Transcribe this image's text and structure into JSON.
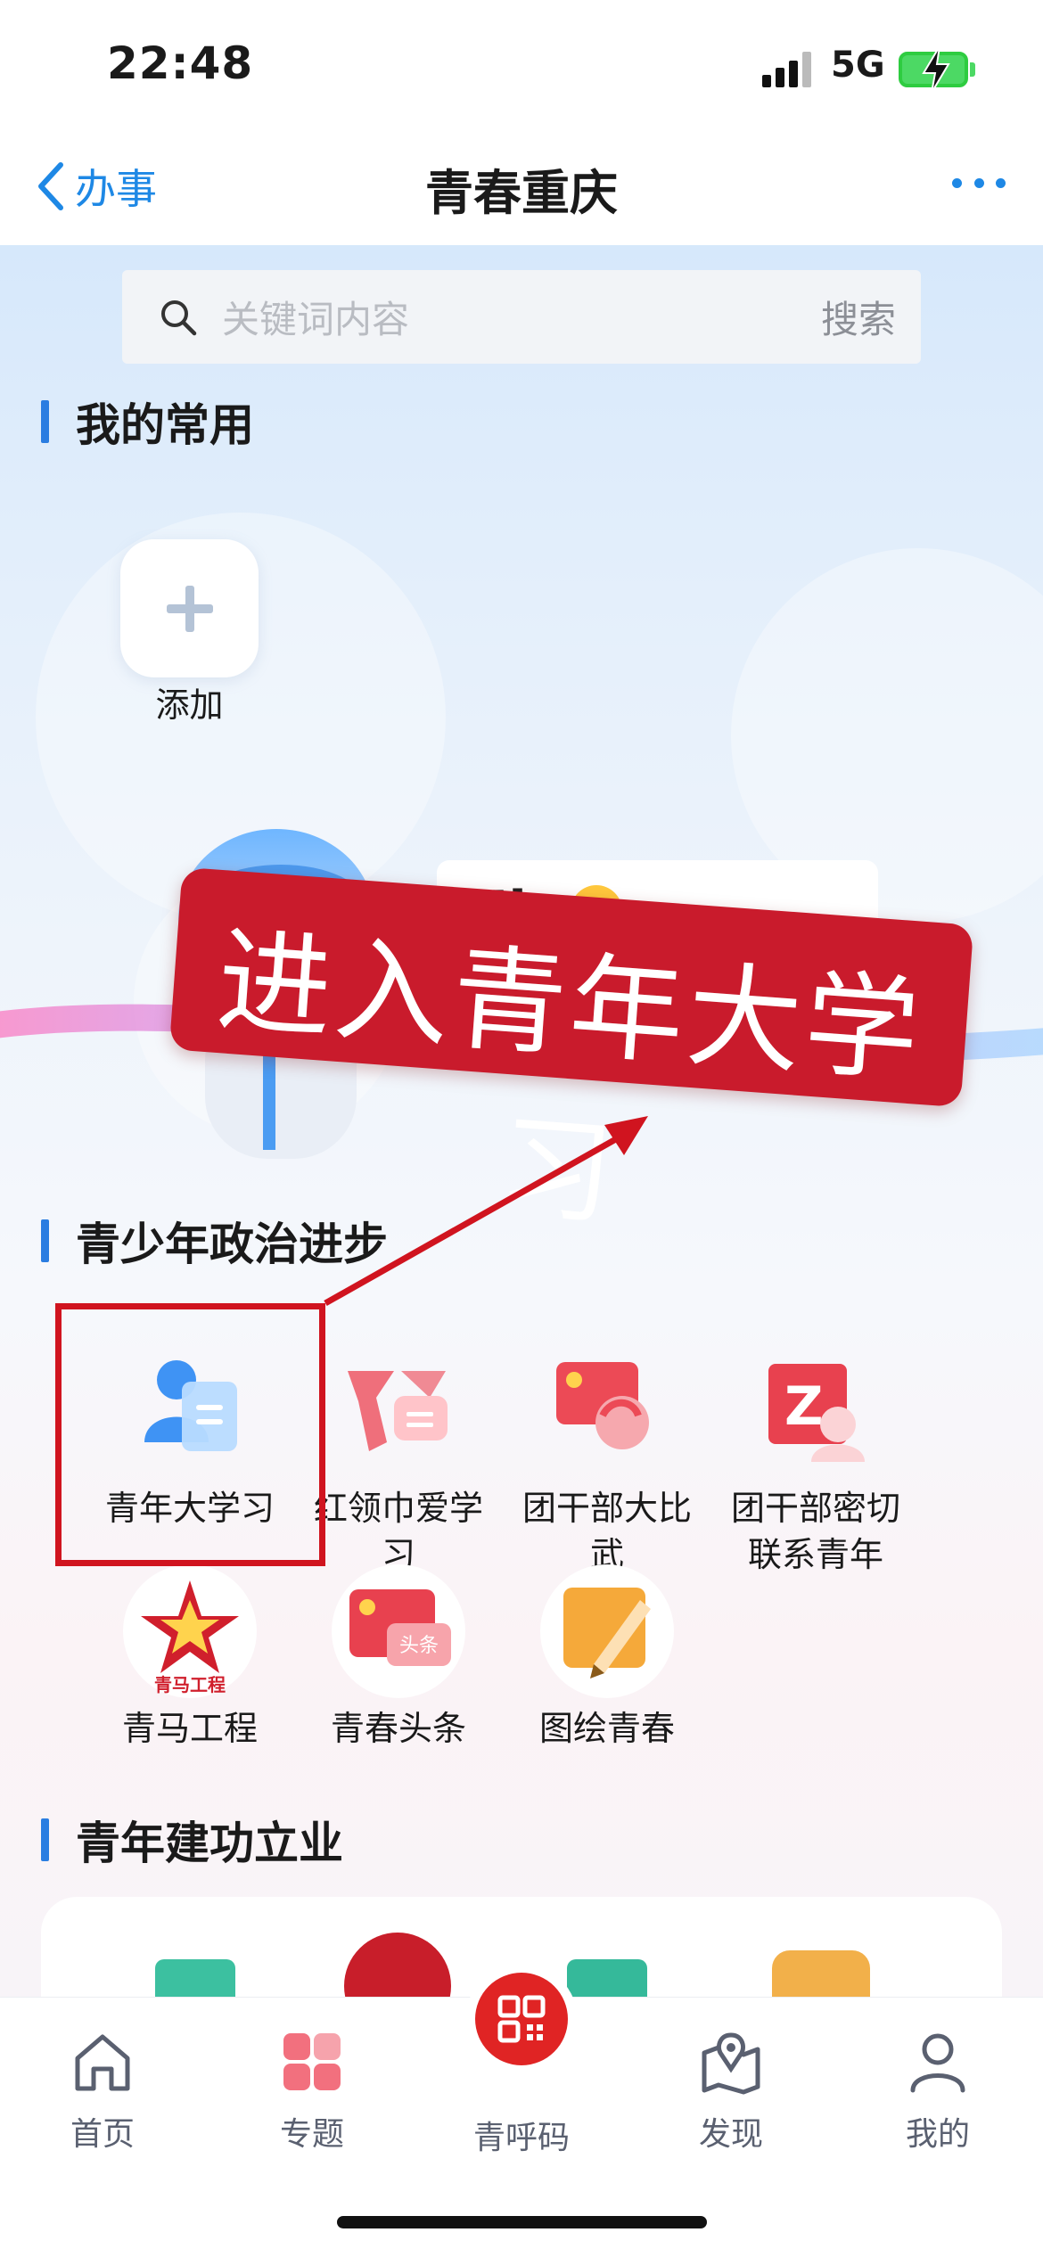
{
  "status_bar": {
    "time": "22:48",
    "network": "5G"
  },
  "nav": {
    "back_label": "办事",
    "title": "青春重庆"
  },
  "search": {
    "placeholder": "关键词内容",
    "button": "搜索"
  },
  "sections": {
    "favorites": "我的常用",
    "politics": "青少年政治进步",
    "career": "青年建功立业"
  },
  "favorites": {
    "add_label": "添加"
  },
  "banner": {
    "greeting": "Hi~",
    "overlay_text": "进入青年大学习"
  },
  "politics_items": [
    {
      "label": "青年大学习",
      "icon": "study-icon"
    },
    {
      "label": "红领巾爱学习",
      "icon": "red-scarf-icon"
    },
    {
      "label": "团干部大比武",
      "icon": "competition-icon"
    },
    {
      "label": "团干部密切联系青年",
      "icon": "contact-icon"
    },
    {
      "label": "青马工程",
      "icon": "qingma-star-icon",
      "logo_text": "青马工程"
    },
    {
      "label": "青春头条",
      "icon": "headline-icon",
      "badge": "头条"
    },
    {
      "label": "图绘青春",
      "icon": "drawing-icon"
    }
  ],
  "tabbar": [
    {
      "label": "首页",
      "icon": "home-icon"
    },
    {
      "label": "专题",
      "icon": "topics-icon"
    },
    {
      "label": "青呼码",
      "icon": "qr-code-icon"
    },
    {
      "label": "发现",
      "icon": "discover-icon"
    },
    {
      "label": "我的",
      "icon": "profile-icon"
    }
  ],
  "colors": {
    "accent": "#1e88e5",
    "section_bar": "#2a7de1",
    "annotation_red": "#d0141f",
    "tab_center": "#e02424"
  }
}
